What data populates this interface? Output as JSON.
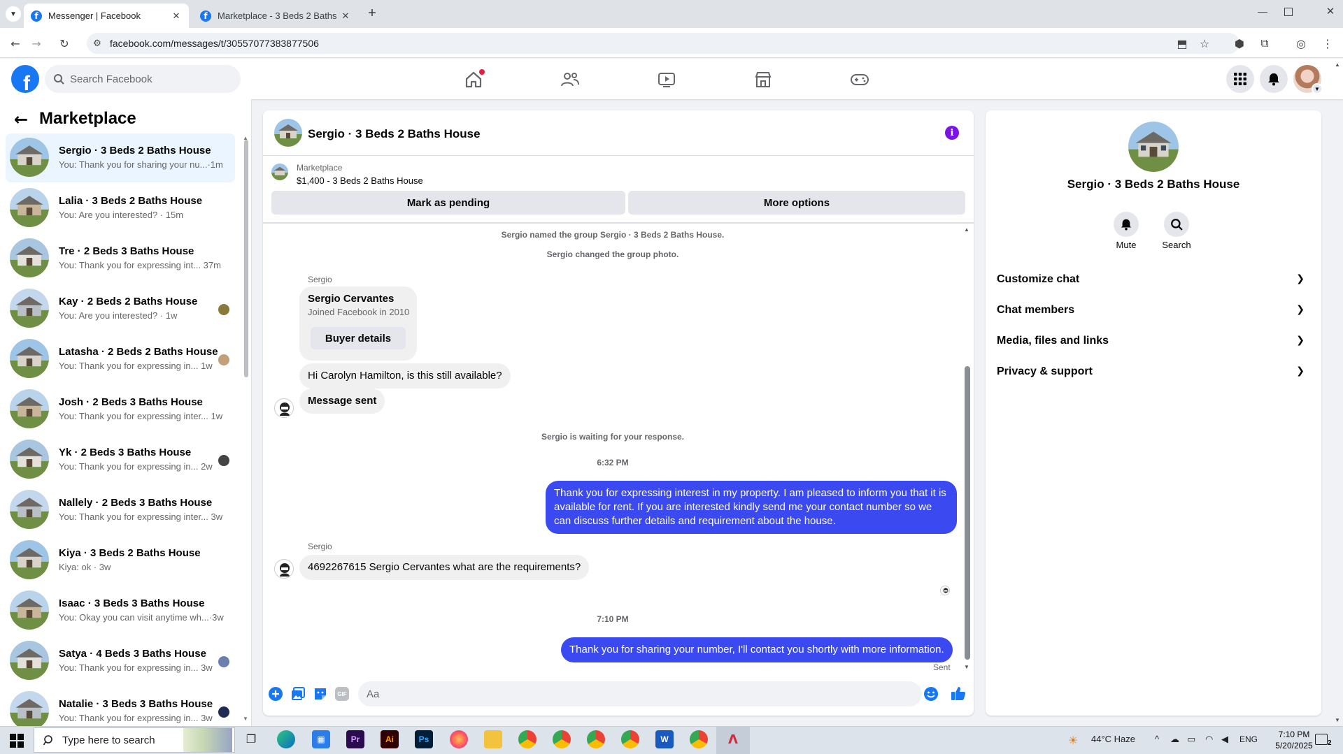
{
  "browser": {
    "tabs": [
      {
        "title": "Messenger | Facebook",
        "active": true
      },
      {
        "title": "Marketplace - 3 Beds 2 Baths H",
        "active": false
      }
    ],
    "url": "facebook.com/messages/t/30557077383877506"
  },
  "fb_header": {
    "search_placeholder": "Search Facebook"
  },
  "left_panel": {
    "title": "Marketplace",
    "conversations": [
      {
        "name": "Sergio · 3 Beds 2 Baths House",
        "preview": "You: Thank you for sharing your nu...·1m",
        "selected": true
      },
      {
        "name": "Lalia · 3 Beds 2 Baths House",
        "preview": "You: Are you interested? · 15m"
      },
      {
        "name": "Tre · 2 Beds 3 Baths House",
        "preview": "You: Thank you for expressing int...  37m"
      },
      {
        "name": "Kay · 2 Beds 2 Baths House",
        "preview": "You: Are you interested? · 1w"
      },
      {
        "name": "Latasha · 2 Beds 2 Baths House",
        "preview": "You: Thank you for expressing in...  1w"
      },
      {
        "name": "Josh · 2 Beds 3 Baths House",
        "preview": "You: Thank you for expressing inter...  1w"
      },
      {
        "name": "Yk · 2 Beds 3 Baths House",
        "preview": "You: Thank you for expressing in...  2w"
      },
      {
        "name": "Nallely · 2 Beds 3 Baths House",
        "preview": "You: Thank you for expressing inter...  3w"
      },
      {
        "name": "Kiya · 3 Beds 2 Baths House",
        "preview": "Kiya: ok · 3w"
      },
      {
        "name": "Isaac · 3 Beds 3 Baths House",
        "preview": "You: Okay you can visit anytime wh...·3w"
      },
      {
        "name": "Satya · 4 Beds 3 Baths House",
        "preview": "You: Thank you for expressing in...  3w"
      },
      {
        "name": "Natalie · 3 Beds 3 Baths House",
        "preview": "You: Thank you for expressing in...  3w"
      }
    ]
  },
  "chat": {
    "title": "Sergio · 3 Beds 2 Baths House",
    "listing_source": "Marketplace",
    "listing_title": "$1,400 - 3 Beds 2 Baths House",
    "mark_pending_label": "Mark as pending",
    "more_options_label": "More options",
    "system_1": "Sergio named the group Sergio · 3 Beds 2 Baths House.",
    "system_2": "Sergio changed the group photo.",
    "sender_name_1": "Sergio",
    "buyer_name": "Sergio Cervantes",
    "buyer_joined": "Joined Facebook in 2010",
    "buyer_details_label": "Buyer details",
    "msg_in_1": "Hi Carolyn Hamilton, is this still available?",
    "msg_in_2": "Message sent",
    "system_3": "Sergio is waiting for your response.",
    "time_1": "6:32 PM",
    "msg_out_1": "Thank you for expressing interest in my property. I am pleased to inform you that it is available for rent. If you are interested kindly send me your contact number so we can discuss further details and requirement about the house.",
    "sender_name_2": "Sergio",
    "msg_in_3": "4692267615 Sergio Cervantes what are the requirements?",
    "time_2": "7:10 PM",
    "msg_out_2": "Thank you for sharing your number, I'll contact you shortly with more information.",
    "sent_status": "Sent",
    "composer_placeholder": "Aa"
  },
  "right_panel": {
    "title": "Sergio · 3 Beds 2 Baths House",
    "mute_label": "Mute",
    "search_label": "Search",
    "sections": [
      "Customize chat",
      "Chat members",
      "Media, files and links",
      "Privacy & support"
    ]
  },
  "taskbar": {
    "search_placeholder": "Type here to search",
    "weather": "44°C  Haze",
    "language": "ENG",
    "time": "7:10 PM",
    "date": "5/20/2025",
    "notification_count": "2"
  },
  "colors": {
    "fb_blue": "#1877f2",
    "outgoing_bubble": "#3b49f0",
    "info_purple": "#7b12e6"
  }
}
